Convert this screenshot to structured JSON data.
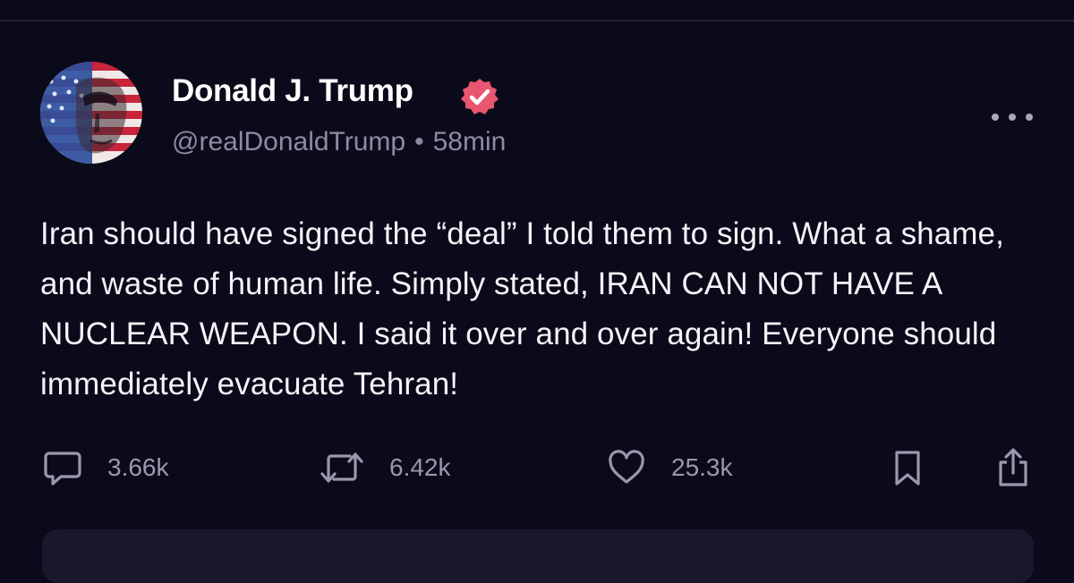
{
  "post": {
    "author": {
      "display_name": "Donald J. Trump",
      "handle": "@realDonaldTrump",
      "verified": true,
      "avatar": "flag-portrait-avatar"
    },
    "separator": "•",
    "time_ago": "58min",
    "text": "Iran should have signed the “deal” I told them to sign. What a shame, and waste of human life. Simply stated, IRAN CAN NOT HAVE A NUCLEAR WEAPON. I said it over and over again! Everyone should immediately evacuate Tehran!",
    "actions": {
      "replies": "3.66k",
      "reposts": "6.42k",
      "likes": "25.3k"
    }
  },
  "icons": {
    "more": "more-horizontal-icon",
    "reply": "comment-bubble-icon",
    "repost": "repost-arrows-icon",
    "like": "heart-icon",
    "bookmark": "bookmark-icon",
    "share": "share-upload-icon",
    "verified": "verified-badge-icon"
  },
  "colors": {
    "background": "#0b0a1a",
    "text": "#f4f3f8",
    "muted": "#8d8aa2",
    "verified_badge": "#e8566f"
  }
}
